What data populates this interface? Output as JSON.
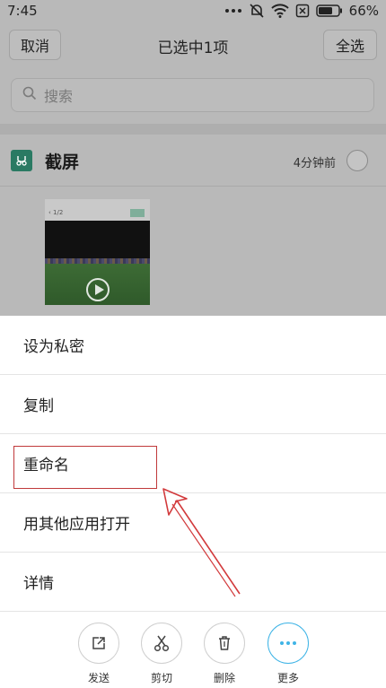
{
  "status_bar": {
    "time": "7:45",
    "battery": "66%"
  },
  "header": {
    "cancel_label": "取消",
    "title": "已选中1项",
    "select_all_label": "全选"
  },
  "search": {
    "placeholder": "搜索"
  },
  "section": {
    "title": "截屏",
    "time": "4分钟前"
  },
  "menu": {
    "items": [
      {
        "label": "设为私密"
      },
      {
        "label": "复制"
      },
      {
        "label": "重命名"
      },
      {
        "label": "用其他应用打开"
      },
      {
        "label": "详情"
      }
    ]
  },
  "toolbar": {
    "items": [
      {
        "label": "发送",
        "icon": "send-icon"
      },
      {
        "label": "剪切",
        "icon": "scissors-icon"
      },
      {
        "label": "删除",
        "icon": "trash-icon"
      },
      {
        "label": "更多",
        "icon": "more-icon"
      }
    ]
  },
  "colors": {
    "highlight": "#c0393b",
    "accent": "#3fb4e6",
    "folder": "#2a7a63"
  }
}
